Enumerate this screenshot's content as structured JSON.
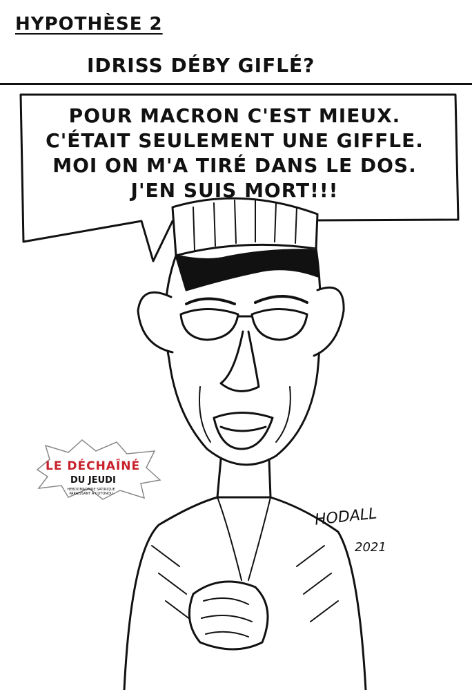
{
  "heading": "HYPOTHÈSE 2",
  "subheading": "IDRISS DÉBY GIFLÉ?",
  "speech_bubble": {
    "lines": [
      "POUR MACRON C'EST MIEUX.",
      "C'ÉTAIT SEULEMENT UNE GIFFLE.",
      "MOI ON M'A TIRÉ DANS LE DOS.",
      "J'EN SUIS MORT!!!"
    ]
  },
  "logo": {
    "title": "LE DÉCHAÎNÉ",
    "subtitle": "DU JEUDI",
    "tagline": "HEBDOMADAIRE SATIRIQUE PARAISSANT À COTONOU",
    "accent_color": "#c8202a"
  },
  "signature": {
    "name": "HODALL",
    "year": "2021"
  }
}
